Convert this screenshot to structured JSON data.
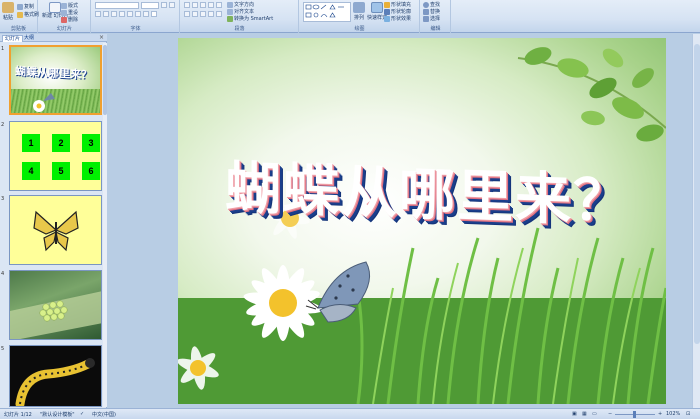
{
  "ribbon": {
    "clipboard": {
      "paste": "粘贴",
      "copy": "复制",
      "format_painter": "格式刷",
      "group_label": "剪贴板"
    },
    "slides": {
      "new_slide": "新建\n幻灯片",
      "layout": "版式",
      "reset": "重设",
      "delete": "删除",
      "group_label": "幻灯片"
    },
    "font": {
      "group_label": "字体"
    },
    "paragraph": {
      "text_direction": "文字方向",
      "align_text": "对齐文本",
      "convert_smartart": "转换为 SmartArt",
      "group_label": "段落"
    },
    "drawing": {
      "arrange": "排列",
      "quick_styles": "快速样式",
      "shape_fill": "形状填充",
      "shape_outline": "形状轮廓",
      "shape_effects": "形状效果",
      "group_label": "绘图"
    },
    "editing": {
      "find": "查找",
      "replace": "替换",
      "select": "选择",
      "group_label": "编辑"
    }
  },
  "left_pane": {
    "tabs": [
      "幻灯片",
      "大纲"
    ],
    "close_glyph": "×",
    "slides": [
      {
        "num": "1",
        "title": "蝴蝶从哪里来？"
      },
      {
        "num": "2",
        "squares": [
          "1",
          "2",
          "3",
          "4",
          "5",
          "6"
        ]
      },
      {
        "num": "3"
      },
      {
        "num": "4"
      },
      {
        "num": "5"
      }
    ]
  },
  "slide": {
    "title": "蝴蝶从哪里来？"
  },
  "status": {
    "slide_counter": "幻灯片 1/12",
    "theme": "\"默认设计模板\"",
    "language": "中文(中国)",
    "zoom": "102%"
  },
  "colors": {
    "square_green": "#00f000",
    "title_shadow": "#1a3f8c",
    "title_pink": "#e07080"
  }
}
